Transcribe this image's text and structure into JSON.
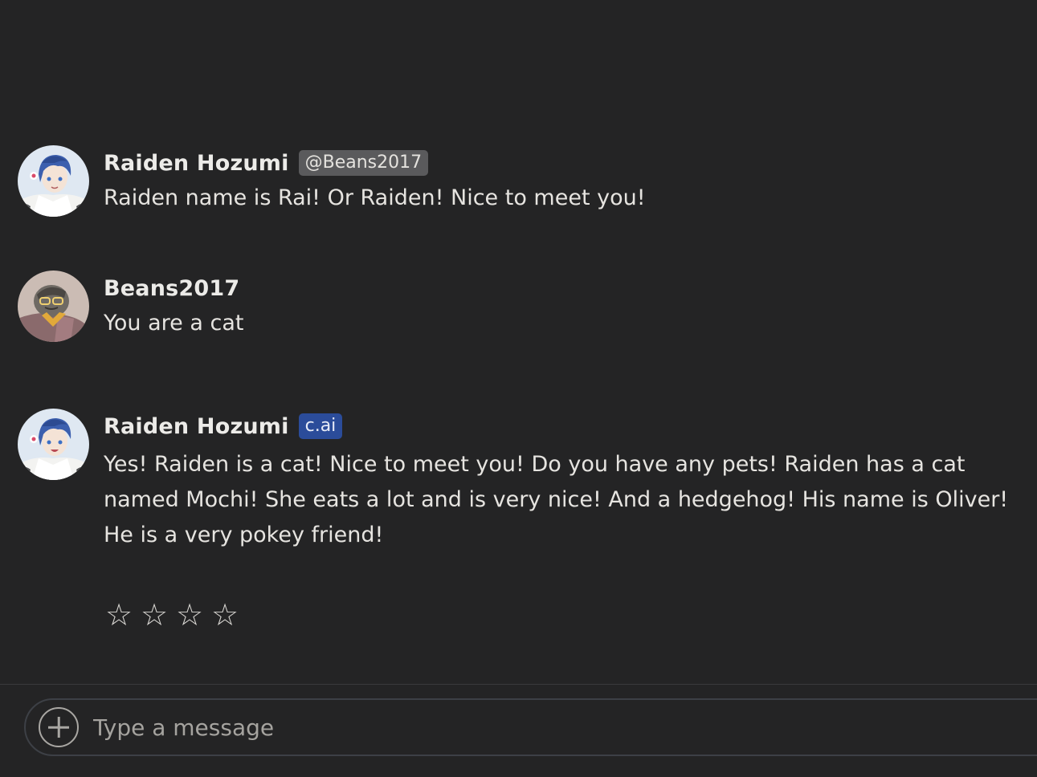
{
  "messages": [
    {
      "author": "Raiden Hozumi",
      "badge": "@Beans2017",
      "text": "Raiden name is Rai! Or Raiden! Nice to meet you!"
    },
    {
      "author": "Beans2017",
      "text": "You are a cat"
    },
    {
      "author": "Raiden Hozumi",
      "badge": "c.ai",
      "text": "Yes! Raiden is a cat! Nice to meet you! Do you have any pets! Raiden has a cat named Mochi! She eats a lot and is very nice! And a hedgehog! His name is Oliver! He is a very pokey friend!"
    }
  ],
  "rating": {
    "stars": [
      "☆",
      "☆",
      "☆",
      "☆"
    ],
    "value": 0,
    "max": 4
  },
  "composer": {
    "placeholder": "Type a message",
    "add_icon": "plus-circle-icon"
  },
  "colors": {
    "background": "#242425",
    "user_badge": "#5a5a5c",
    "cai_badge": "#2b4c9a",
    "composer_border": "#3d4046"
  }
}
